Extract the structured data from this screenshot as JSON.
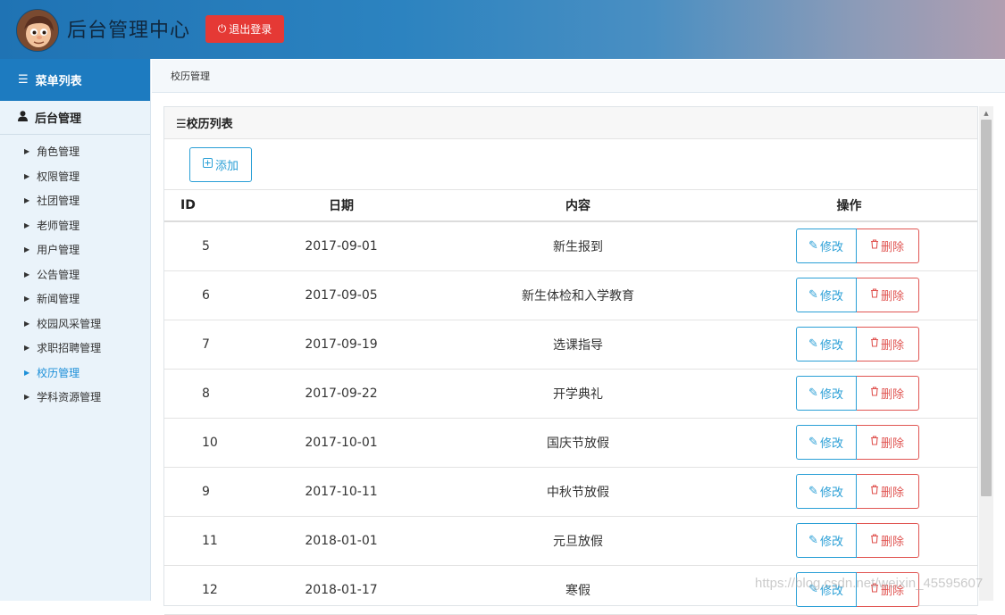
{
  "header": {
    "title": "后台管理中心",
    "logout_label": "退出登录"
  },
  "sidebar": {
    "menu_title": "菜单列表",
    "group_title": "后台管理",
    "items": [
      {
        "label": "角色管理"
      },
      {
        "label": "权限管理"
      },
      {
        "label": "社团管理"
      },
      {
        "label": "老师管理"
      },
      {
        "label": "用户管理"
      },
      {
        "label": "公告管理"
      },
      {
        "label": "新闻管理"
      },
      {
        "label": "校园风采管理"
      },
      {
        "label": "求职招聘管理"
      },
      {
        "label": "校历管理",
        "active": true
      },
      {
        "label": "学科资源管理"
      }
    ]
  },
  "breadcrumb": "校历管理",
  "panel": {
    "title": "☰校历列表",
    "add_label": "添加"
  },
  "table": {
    "columns": [
      "ID",
      "日期",
      "内容",
      "操作"
    ],
    "edit_label": "修改",
    "delete_label": "删除",
    "rows": [
      {
        "id": "5",
        "date": "2017-09-01",
        "content": "新生报到"
      },
      {
        "id": "6",
        "date": "2017-09-05",
        "content": "新生体检和入学教育"
      },
      {
        "id": "7",
        "date": "2017-09-19",
        "content": "选课指导"
      },
      {
        "id": "8",
        "date": "2017-09-22",
        "content": "开学典礼"
      },
      {
        "id": "10",
        "date": "2017-10-01",
        "content": "国庆节放假"
      },
      {
        "id": "9",
        "date": "2017-10-11",
        "content": "中秋节放假"
      },
      {
        "id": "11",
        "date": "2018-01-01",
        "content": "元旦放假"
      },
      {
        "id": "12",
        "date": "2018-01-17",
        "content": "寒假"
      }
    ]
  },
  "watermark": "https://blog.csdn.net/weixin_45595607",
  "colors": {
    "header_blue": "#1f73b4",
    "logout_red": "#e53935",
    "primary_blue": "#2a9fd6",
    "danger_red": "#e05552",
    "active_link": "#1c8fd8"
  }
}
